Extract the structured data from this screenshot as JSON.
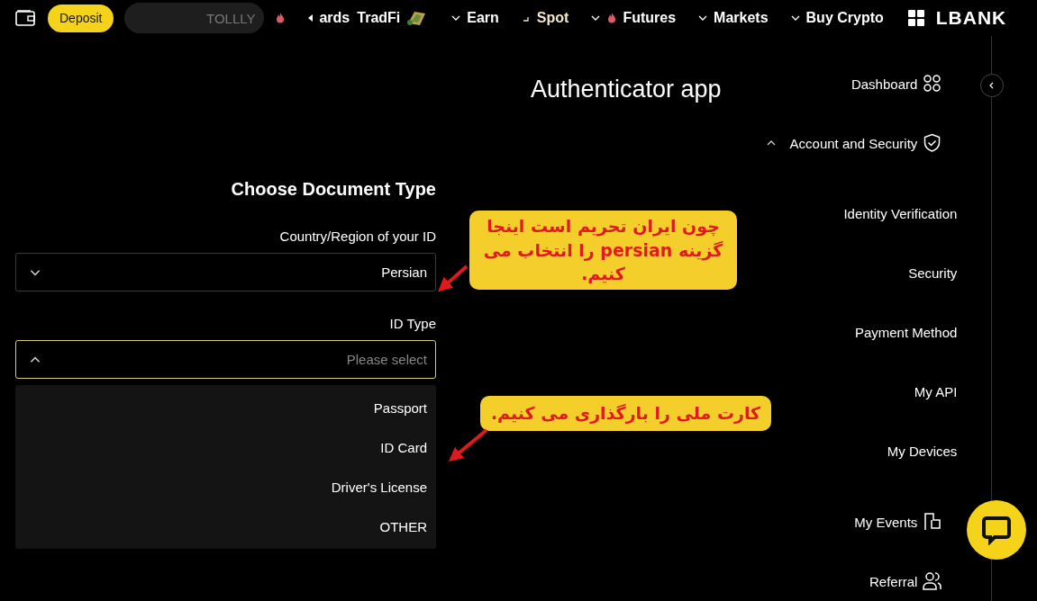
{
  "nav": {
    "deposit": "Deposit",
    "search_text": "TOLLLY",
    "items": [
      {
        "label": "ards",
        "kind": "back",
        "selected": false
      },
      {
        "label": "TradFi",
        "kind": "badge",
        "selected": false
      },
      {
        "label": "Earn",
        "kind": "dropdown",
        "selected": false
      },
      {
        "label": "Spot",
        "kind": "dropdown",
        "selected": true
      },
      {
        "label": "Futures",
        "kind": "hot",
        "selected": false
      },
      {
        "label": "Markets",
        "kind": "dropdown",
        "selected": false
      },
      {
        "label": "Buy Crypto",
        "kind": "dropdown",
        "selected": false
      }
    ],
    "logo": "LBANK"
  },
  "page_title": "Authenticator app",
  "form": {
    "title": "Choose Document Type",
    "country": {
      "label": "Country/Region of your ID",
      "value": "Persian",
      "expanded": false
    },
    "id_type": {
      "label": "ID Type",
      "placeholder": "Please select",
      "expanded": true,
      "options": [
        "Passport",
        "ID Card",
        "Driver's License",
        "OTHER"
      ]
    }
  },
  "sidebar": {
    "items": [
      {
        "label": "Dashboard",
        "kind": "grid"
      },
      {
        "label": "Account and Security",
        "kind": "shield",
        "expanded": true,
        "children": [
          {
            "label": "Identity Verification"
          },
          {
            "label": "Security"
          },
          {
            "label": "Payment Method"
          },
          {
            "label": "My API"
          },
          {
            "label": "My Devices"
          }
        ]
      },
      {
        "label": "My Events",
        "kind": "flag"
      },
      {
        "label": "Referral",
        "kind": "people"
      }
    ]
  },
  "annotations": [
    {
      "text": "چون ایران تحریم است اینجا گزینه persian را انتخاب می کنیم."
    },
    {
      "text": "کارت ملی را بارگذاری می کنیم."
    }
  ]
}
